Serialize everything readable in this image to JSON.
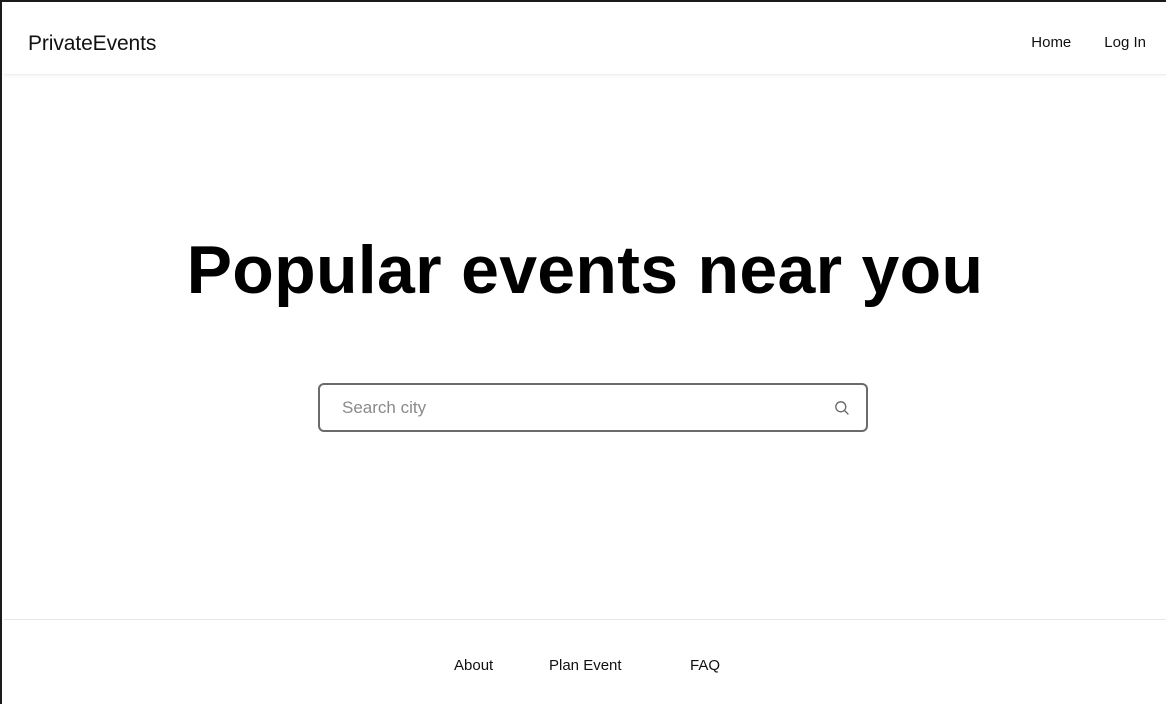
{
  "navbar": {
    "brand": "PrivateEvents",
    "links": [
      {
        "label": "Home"
      },
      {
        "label": "Log In"
      }
    ]
  },
  "hero": {
    "title": "Popular events near you"
  },
  "search": {
    "placeholder": "Search city",
    "value": "",
    "icon": "search-icon"
  },
  "footer": {
    "links": [
      {
        "label": "About"
      },
      {
        "label": "Plan Event"
      },
      {
        "label": "FAQ"
      }
    ]
  },
  "colors": {
    "background": "#ffffff",
    "text": "#111111",
    "title": "#000000",
    "border": "#6b6b6b",
    "placeholder": "#8a8a8a"
  }
}
